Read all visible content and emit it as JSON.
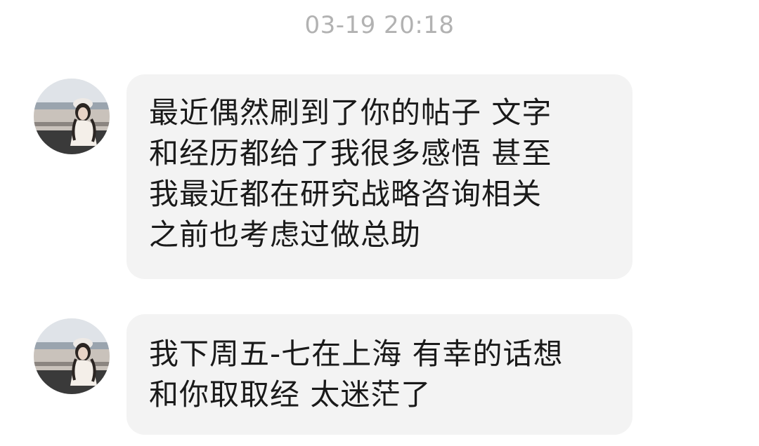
{
  "chat": {
    "timestamp": "03-19 20:18",
    "messages": [
      {
        "sender_avatar": "contact-avatar-photo",
        "text": "最近偶然刷到了你的帖子 文字\n和经历都给了我很多感悟 甚至\n我最近都在研究战略咨询相关\n之前也考虑过做总助"
      },
      {
        "sender_avatar": "contact-avatar-photo",
        "text": "我下周五-七在上海 有幸的话想\n和你取取经 太迷茫了"
      }
    ]
  }
}
